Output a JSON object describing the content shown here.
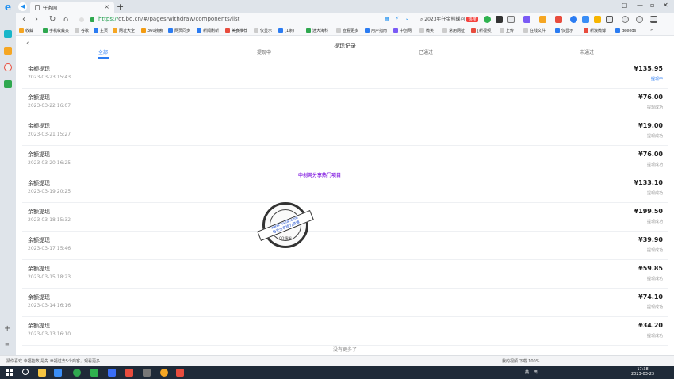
{
  "browser": {
    "tab_title": "任务网",
    "url_host": "dt.bd.cn",
    "url_protocol": "https://",
    "url_path": "/#/pages/withdraw/components/list",
    "search_query": "2023年任金熊蝶问",
    "search_badge": "热搜",
    "new_tab_label": "+",
    "bookmarks": [
      "收藏",
      "手机收藏夹",
      "谷歌",
      "主页",
      "网址大全",
      "360搜索",
      "网页同步",
      "新闻刷新",
      "美食推荐",
      "仅显示",
      "(1条)",
      "迷大海科",
      "查看更多",
      "用户指南",
      "中创网",
      "微笑",
      "常用网址",
      "[新视频]",
      "上传",
      "在线文件",
      "仅显示",
      "新浪微博",
      "deeeds"
    ]
  },
  "page": {
    "title": "提现记录",
    "tabs": [
      {
        "label": "全部",
        "active": true
      },
      {
        "label": "提现中",
        "active": false
      },
      {
        "label": "已通过",
        "active": false
      },
      {
        "label": "未通过",
        "active": false
      }
    ],
    "records": [
      {
        "title": "余额提现",
        "time": "2023-03-23 15:43",
        "amount": "¥135.95",
        "status": "提现中",
        "pending": true
      },
      {
        "title": "余额提现",
        "time": "2023-03-22 16:07",
        "amount": "¥76.00",
        "status": "提现成功",
        "pending": false
      },
      {
        "title": "余额提现",
        "time": "2023-03-21 15:27",
        "amount": "¥19.00",
        "status": "提现成功",
        "pending": false
      },
      {
        "title": "余额提现",
        "time": "2023-03-20 16:25",
        "amount": "¥76.00",
        "status": "提现成功",
        "pending": false
      },
      {
        "title": "余额提现",
        "time": "2023-03-19 20:25",
        "amount": "¥133.10",
        "status": "提现成功",
        "pending": false
      },
      {
        "title": "余额提现",
        "time": "2023-03-18 15:32",
        "amount": "¥199.50",
        "status": "提现成功",
        "pending": false
      },
      {
        "title": "余额提现",
        "time": "2023-03-17 15:46",
        "amount": "¥39.90",
        "status": "提现成功",
        "pending": false
      },
      {
        "title": "余额提现",
        "time": "2023-03-15 18:23",
        "amount": "¥59.85",
        "status": "提现成功",
        "pending": false
      },
      {
        "title": "余额提现",
        "time": "2023-03-14 16:16",
        "amount": "¥74.10",
        "status": "提现成功",
        "pending": false
      },
      {
        "title": "余额提现",
        "time": "2023-03-13 16:10",
        "amount": "¥34.20",
        "status": "提现成功",
        "pending": false
      }
    ],
    "no_more": "没有更多了",
    "watermark_text": "中创网分享热门项目",
    "stamp": {
      "line1": "www.Yuulai.com",
      "line2": "每天分享给力资源",
      "line3": "QQ:客服"
    }
  },
  "statusbar": {
    "left": "猜你喜欢  幸福指数 是先 幸福过去5个商客，观看更多",
    "right": "我的视频  下载  100%"
  },
  "taskbar": {
    "time": "17:38",
    "date": "2023-03-23",
    "tray_text": "英 田"
  },
  "colors": {
    "accent": "#2b7cf2",
    "pending": "#2b7cf2",
    "watermark": "#8a2be2",
    "url_green": "#1a9c47"
  }
}
